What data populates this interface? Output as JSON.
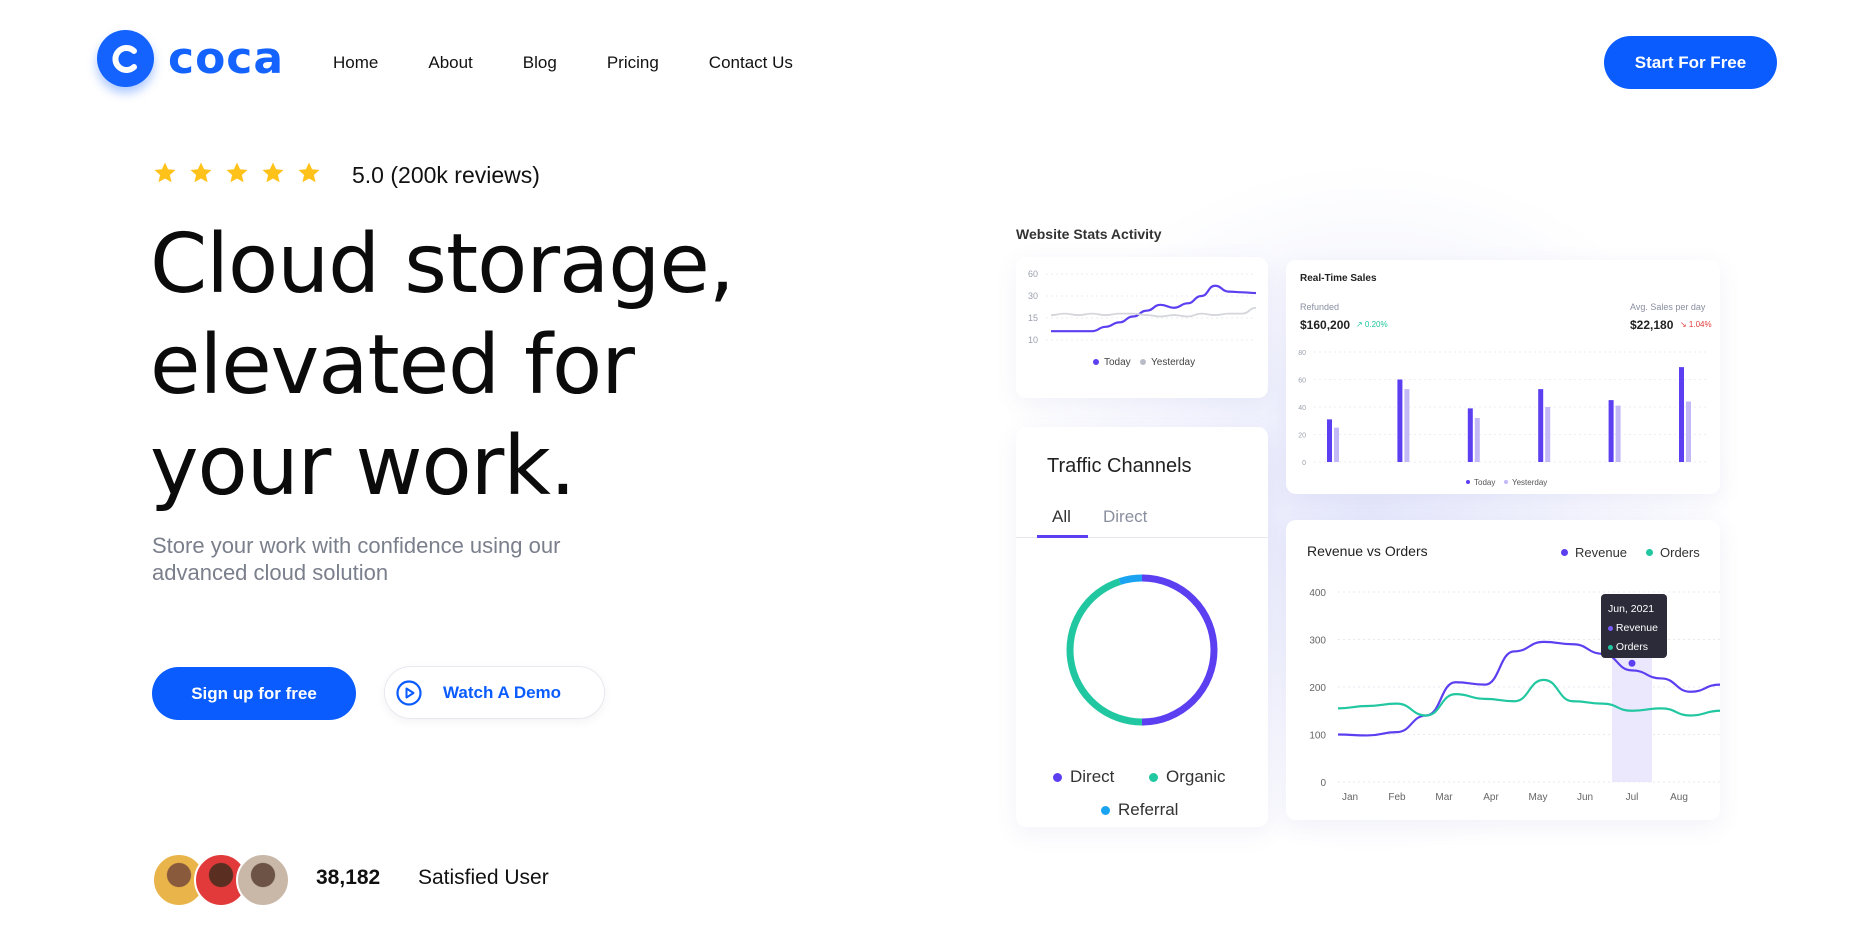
{
  "brand": {
    "name": "coca",
    "color": "#1463ff"
  },
  "nav": {
    "items": [
      "Home",
      "About",
      "Blog",
      "Pricing",
      "Contact Us"
    ],
    "cta": "Start For Free"
  },
  "hero": {
    "stars": 5,
    "rating_text": "5.0 (200k reviews)",
    "headline": [
      "Cloud storage,",
      "elevated for",
      "your work."
    ],
    "subtitle_lines": [
      "Store your work with confidence using our",
      "advanced cloud solution"
    ],
    "primary_button": "Sign up for free",
    "demo_button": "Watch A Demo",
    "users_count": "38,182",
    "users_label": "Satisfied User"
  },
  "dashboard": {
    "stats_title": "Website Stats Activity",
    "realtime": {
      "title": "Real-Time Sales",
      "refunded_label": "Refunded",
      "refunded_value": "$160,200",
      "refunded_change": "↗ 0.20%",
      "avg_label": "Avg. Sales per day",
      "avg_value": "$22,180",
      "avg_change": "↘ 1.04%"
    },
    "traffic": {
      "title": "Traffic Channels",
      "tabs": [
        "All",
        "Direct"
      ],
      "legend": [
        "Direct",
        "Organic",
        "Referral"
      ]
    },
    "revenue_orders": {
      "title": "Revenue vs Orders",
      "legend": [
        "Revenue",
        "Orders"
      ],
      "tooltip": {
        "date": "Jun, 2021",
        "items": [
          "Revenue",
          "Orders"
        ]
      }
    },
    "colors": {
      "purple": "#5b3ff0",
      "lilac": "#c3b9f7",
      "teal": "#21c7a0",
      "blue": "#1aa3f0",
      "gray": "#d4d6dc"
    }
  },
  "chart_data": [
    {
      "type": "line",
      "title": "",
      "y_ticks": [
        60,
        30,
        15,
        10
      ],
      "series": [
        {
          "name": "Today",
          "values": [
            12,
            12,
            12,
            12,
            13,
            14,
            16,
            20,
            24,
            22,
            25,
            30,
            44,
            36,
            35,
            34
          ]
        },
        {
          "name": "Yesterday",
          "values": [
            17,
            18,
            17,
            18,
            17,
            18,
            18,
            17,
            16,
            17,
            16,
            18,
            17,
            18,
            18,
            22
          ]
        }
      ]
    },
    {
      "type": "bar",
      "title": "Real-Time Sales",
      "y_ticks": [
        80,
        60,
        40,
        20,
        0
      ],
      "ylim": [
        0,
        80
      ],
      "series": [
        {
          "name": "Today",
          "values": [
            31,
            60,
            39,
            53,
            45,
            69
          ]
        },
        {
          "name": "Yesterday",
          "values": [
            25,
            53,
            32,
            40,
            41,
            44
          ]
        }
      ]
    },
    {
      "type": "pie",
      "title": "Traffic Channels",
      "categories": [
        "Direct",
        "Organic",
        "Referral"
      ],
      "values": [
        50,
        45,
        5
      ]
    },
    {
      "type": "line",
      "title": "Revenue vs Orders",
      "x_ticks": [
        "Jan",
        "Feb",
        "Mar",
        "Apr",
        "May",
        "Jun",
        "Jul",
        "Aug"
      ],
      "y_ticks": [
        400,
        300,
        200,
        100,
        0
      ],
      "ylim": [
        0,
        400
      ],
      "series": [
        {
          "name": "Revenue",
          "values": [
            100,
            98,
            105,
            140,
            210,
            205,
            275,
            295,
            290,
            270,
            235,
            218,
            190,
            205
          ]
        },
        {
          "name": "Orders",
          "values": [
            155,
            160,
            165,
            140,
            185,
            175,
            170,
            215,
            170,
            165,
            150,
            155,
            140,
            150
          ]
        }
      ],
      "highlight": "Jul"
    }
  ]
}
